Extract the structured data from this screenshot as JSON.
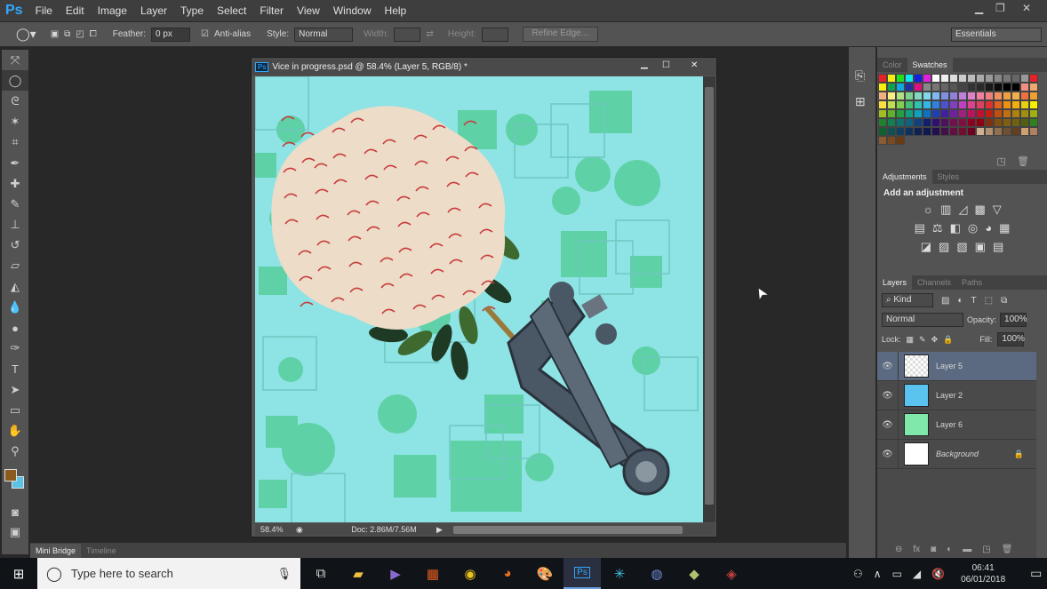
{
  "app": {
    "logo": "Ps"
  },
  "menu": [
    "File",
    "Edit",
    "Image",
    "Layer",
    "Type",
    "Select",
    "Filter",
    "View",
    "Window",
    "Help"
  ],
  "options": {
    "feather_label": "Feather:",
    "feather_value": "0 px",
    "antialias_label": "Anti-alias",
    "antialias_checked": true,
    "style_label": "Style:",
    "style_value": "Normal",
    "width_label": "Width:",
    "height_label": "Height:",
    "refine_edge": "Refine Edge...",
    "workspace": "Essentials"
  },
  "tools": [
    "move",
    "marquee-ellipse",
    "lasso",
    "magic-wand",
    "crop",
    "eyedropper",
    "healing-brush",
    "brush",
    "clone-stamp",
    "history-brush",
    "eraser",
    "paint-bucket",
    "blur",
    "dodge",
    "pen",
    "type",
    "path-selection",
    "rectangle",
    "hand",
    "zoom"
  ],
  "colors": {
    "foreground": "#8b5a1e",
    "background": "#5bc3e8",
    "canvas_bg": "#8ee3e5",
    "canvas_shape": "#5fd1a6",
    "selected_layer": "#5b6a80"
  },
  "document": {
    "title": "Vice in progress.psd @ 58.4% (Layer 5, RGB/8) *",
    "zoom": "58.4%",
    "doc_size": "Doc: 2.86M/7.56M"
  },
  "bottom_tabs": [
    "Mini Bridge",
    "Timeline"
  ],
  "panels": {
    "color_tabs": [
      "Color",
      "Swatches"
    ],
    "swatches": [
      "#e8202a",
      "#f5ee10",
      "#20e020",
      "#10e8f0",
      "#1020e0",
      "#e020e0",
      "#ffffff",
      "#eeeeee",
      "#dddddd",
      "#cccccc",
      "#bbbbbb",
      "#aaaaaa",
      "#999999",
      "#888888",
      "#777777",
      "#666666",
      "#999999",
      "#e8202a",
      "#f5ee10",
      "#10a050",
      "#10a8e0",
      "#2030a0",
      "#e01080",
      "#888888",
      "#777777",
      "#666666",
      "#555555",
      "#444444",
      "#333333",
      "#2a2a2a",
      "#1a1a1a",
      "#0a0a0a",
      "#000000",
      "#000000",
      "#f09080",
      "#f0a870",
      "#f4b080",
      "#f8f080",
      "#b0e080",
      "#80d090",
      "#80d8c0",
      "#80d8e8",
      "#80b8f0",
      "#8090e0",
      "#9080d8",
      "#c080d8",
      "#e080c8",
      "#f080a0",
      "#f08080",
      "#f09060",
      "#f0a040",
      "#f0b050",
      "#f07040",
      "#f0a030",
      "#f8e040",
      "#c0e050",
      "#80d050",
      "#40c070",
      "#30c0b0",
      "#30b8e8",
      "#3080e0",
      "#5050d0",
      "#8040c0",
      "#c040c0",
      "#e04090",
      "#e04060",
      "#e03030",
      "#e06020",
      "#f09010",
      "#f0b010",
      "#e8d010",
      "#f8f000",
      "#a0c020",
      "#60b030",
      "#20a040",
      "#10a080",
      "#10a0c0",
      "#1070c0",
      "#2040b0",
      "#4020a0",
      "#7020a0",
      "#a02080",
      "#c01060",
      "#c01030",
      "#c02010",
      "#c05010",
      "#c07010",
      "#b08010",
      "#a09010",
      "#a0b010",
      "#208030",
      "#108050",
      "#107070",
      "#106080",
      "#104080",
      "#102070",
      "#301070",
      "#501060",
      "#701050",
      "#801040",
      "#900020",
      "#900010",
      "#803010",
      "#805010",
      "#806010",
      "#706010",
      "#506010",
      "#308020",
      "#106030",
      "#105050",
      "#104060",
      "#103060",
      "#102050",
      "#101850",
      "#201050",
      "#401048",
      "#601040",
      "#701030",
      "#700020",
      "#d0b090",
      "#b09070",
      "#907050",
      "#705030",
      "#604020",
      "#d0a070",
      "#b08060",
      "#8a5a30",
      "#7a4a20",
      "#6a3a10"
    ],
    "adjust_tabs": [
      "Adjustments",
      "Styles"
    ],
    "adjust_heading": "Add an adjustment",
    "adjust_icons": [
      [
        "brightness-icon",
        "levels-icon",
        "curves-icon",
        "exposure-icon",
        "vibrance-icon"
      ],
      [
        "hue-saturation-icon",
        "color-balance-icon",
        "black-white-icon",
        "photo-filter-icon",
        "channel-mixer-icon",
        "color-lookup-icon"
      ],
      [
        "invert-icon",
        "posterize-icon",
        "threshold-icon",
        "selective-color-icon",
        "gradient-map-icon"
      ]
    ],
    "layers_tabs": [
      "Layers",
      "Channels",
      "Paths"
    ],
    "filter_kind": "Kind",
    "blend_mode": "Normal",
    "opacity_label": "Opacity:",
    "opacity": "100%",
    "lock_label": "Lock:",
    "fill_label": "Fill:",
    "fill": "100%",
    "layers": [
      {
        "name": "Layer 5",
        "selected": true,
        "thumb": "artwork"
      },
      {
        "name": "Layer 2",
        "thumb": "#5bc3f0"
      },
      {
        "name": "Layer 6",
        "thumb": "#80e8a8"
      },
      {
        "name": "Background",
        "thumb": "#ffffff",
        "italic": true,
        "locked": true
      }
    ]
  },
  "taskbar": {
    "search_placeholder": "Type here to search",
    "time": "06:41",
    "date": "06/01/2018"
  }
}
